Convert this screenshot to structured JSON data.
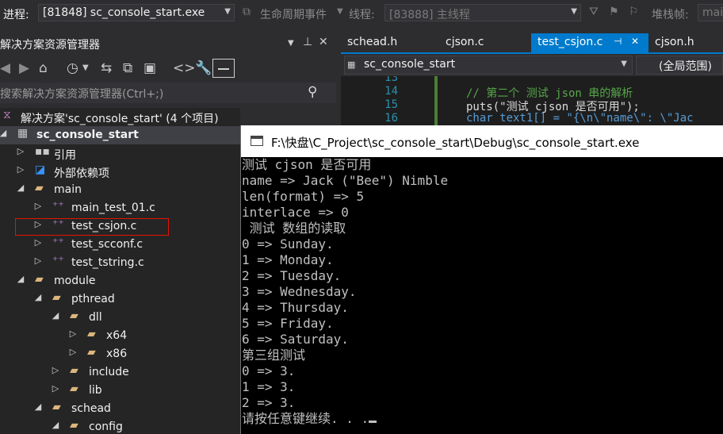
{
  "toolbar": {
    "process_label": "进程:",
    "process_value": "[81848] sc_console_start.exe",
    "lifecycle_label": "生命周期事件",
    "thread_label": "线程:",
    "thread_value": "[83888] 主线程",
    "stack_label": "堆栈帧:",
    "stack_value": "mai"
  },
  "solution_explorer": {
    "title": "解决方案资源管理器",
    "title_icons": [
      "dropdown-icon",
      "pin-icon",
      "close-icon"
    ],
    "search_placeholder": "搜索解决方案资源管理器(Ctrl+;)",
    "tree": [
      {
        "label": "解决方案'sc_console_start' (4 个项目)",
        "level": 0,
        "kind": "solution",
        "expander": "none"
      },
      {
        "label": "sc_console_start",
        "level": 0,
        "kind": "project",
        "expander": "expanded",
        "bold": true,
        "selected": true
      },
      {
        "label": "引用",
        "level": 1,
        "kind": "references",
        "expander": "collapsed"
      },
      {
        "label": "外部依赖项",
        "level": 1,
        "kind": "external",
        "expander": "collapsed"
      },
      {
        "label": "main",
        "level": 1,
        "kind": "folder",
        "expander": "expanded"
      },
      {
        "label": "main_test_01.c",
        "level": 2,
        "kind": "cfile",
        "expander": "collapsed"
      },
      {
        "label": "test_csjon.c",
        "level": 2,
        "kind": "cfile",
        "expander": "collapsed",
        "highlighted": true
      },
      {
        "label": "test_scconf.c",
        "level": 2,
        "kind": "cfile",
        "expander": "collapsed"
      },
      {
        "label": "test_tstring.c",
        "level": 2,
        "kind": "cfile",
        "expander": "collapsed"
      },
      {
        "label": "module",
        "level": 1,
        "kind": "folder",
        "expander": "expanded"
      },
      {
        "label": "pthread",
        "level": 2,
        "kind": "folder",
        "expander": "expanded"
      },
      {
        "label": "dll",
        "level": 3,
        "kind": "folder",
        "expander": "expanded"
      },
      {
        "label": "x64",
        "level": 4,
        "kind": "folder",
        "expander": "collapsed"
      },
      {
        "label": "x86",
        "level": 4,
        "kind": "folder",
        "expander": "collapsed"
      },
      {
        "label": "include",
        "level": 3,
        "kind": "folder",
        "expander": "collapsed"
      },
      {
        "label": "lib",
        "level": 3,
        "kind": "folder",
        "expander": "collapsed"
      },
      {
        "label": "schead",
        "level": 2,
        "kind": "folder",
        "expander": "expanded"
      },
      {
        "label": "config",
        "level": 3,
        "kind": "folder",
        "expander": "expanded"
      }
    ]
  },
  "editor": {
    "tabs": [
      {
        "label": "schead.h",
        "active": false
      },
      {
        "label": "cjson.c",
        "active": false
      },
      {
        "label": "test_csjon.c",
        "active": true
      },
      {
        "label": "cjson.h",
        "active": false
      }
    ],
    "nav_value": "sc_console_start",
    "scope_value": "(全局范围)",
    "lines": [
      {
        "num": "13",
        "code": ""
      },
      {
        "num": "14",
        "code": "// 第二个 测试 json 串的解析"
      },
      {
        "num": "15",
        "code": "puts(\"测试 cjson 是否可用\");"
      },
      {
        "num": "16",
        "code": "char text1[] = \"{\\n\\\"name\\\": \\\"Jac"
      }
    ]
  },
  "console": {
    "title": "F:\\快盘\\C_Project\\sc_console_start\\Debug\\sc_console_start.exe",
    "lines": [
      "测试 cjson 是否可用",
      "name => Jack (\"Bee\") Nimble",
      "len(format) => 5",
      "interlace => 0",
      " 测试 数组的读取",
      "0 => Sunday.",
      "1 => Monday.",
      "2 => Tuesday.",
      "3 => Wednesday.",
      "4 => Thursday.",
      "5 => Friday.",
      "6 => Saturday.",
      "第三组测试",
      "0 => 3.",
      "1 => 3.",
      "2 => 3.",
      "请按任意键继续. . ."
    ]
  },
  "colors": {
    "accent": "#007acc",
    "highlight_border": "#e51400",
    "folder": "#dcb67a",
    "c_file": "#b180d7"
  }
}
